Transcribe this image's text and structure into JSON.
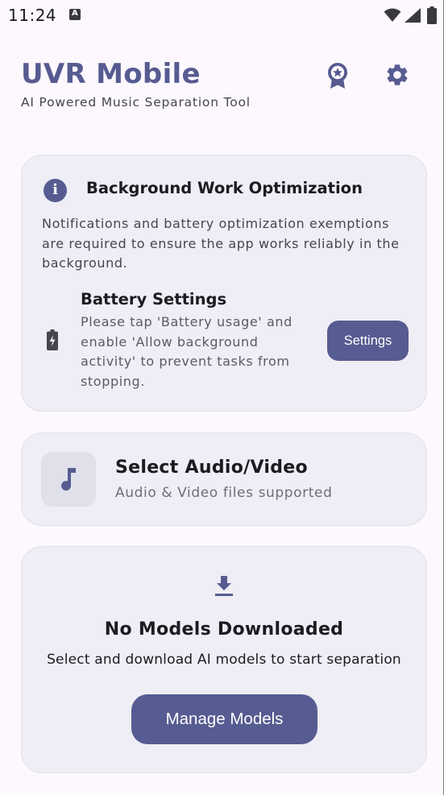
{
  "status_bar": {
    "time": "11:24",
    "notification_letter": "A",
    "icons": [
      "wifi-icon",
      "signal-icon",
      "battery-icon"
    ]
  },
  "header": {
    "title": "UVR Mobile",
    "subtitle": "AI Powered Music Separation Tool",
    "icons": [
      "award-icon",
      "settings-gear-icon"
    ]
  },
  "optimization_card": {
    "title": "Background Work Optimization",
    "description": "Notifications and battery optimization exemptions are required to ensure the app works reliably in the background.",
    "battery": {
      "title": "Battery Settings",
      "description": "Please tap 'Battery usage' and enable 'Allow background activity' to prevent tasks from stopping.",
      "button_label": "Settings"
    }
  },
  "select_card": {
    "title": "Select Audio/Video",
    "subtitle": "Audio & Video files supported"
  },
  "models_card": {
    "title": "No Models Downloaded",
    "subtitle": "Select and download AI models to start separation",
    "button_label": "Manage Models"
  },
  "colors": {
    "primary": "#565b91",
    "background": "#fcf8fd",
    "card": "#efedf5",
    "text": "#1b1b21",
    "muted": "#45464f"
  }
}
